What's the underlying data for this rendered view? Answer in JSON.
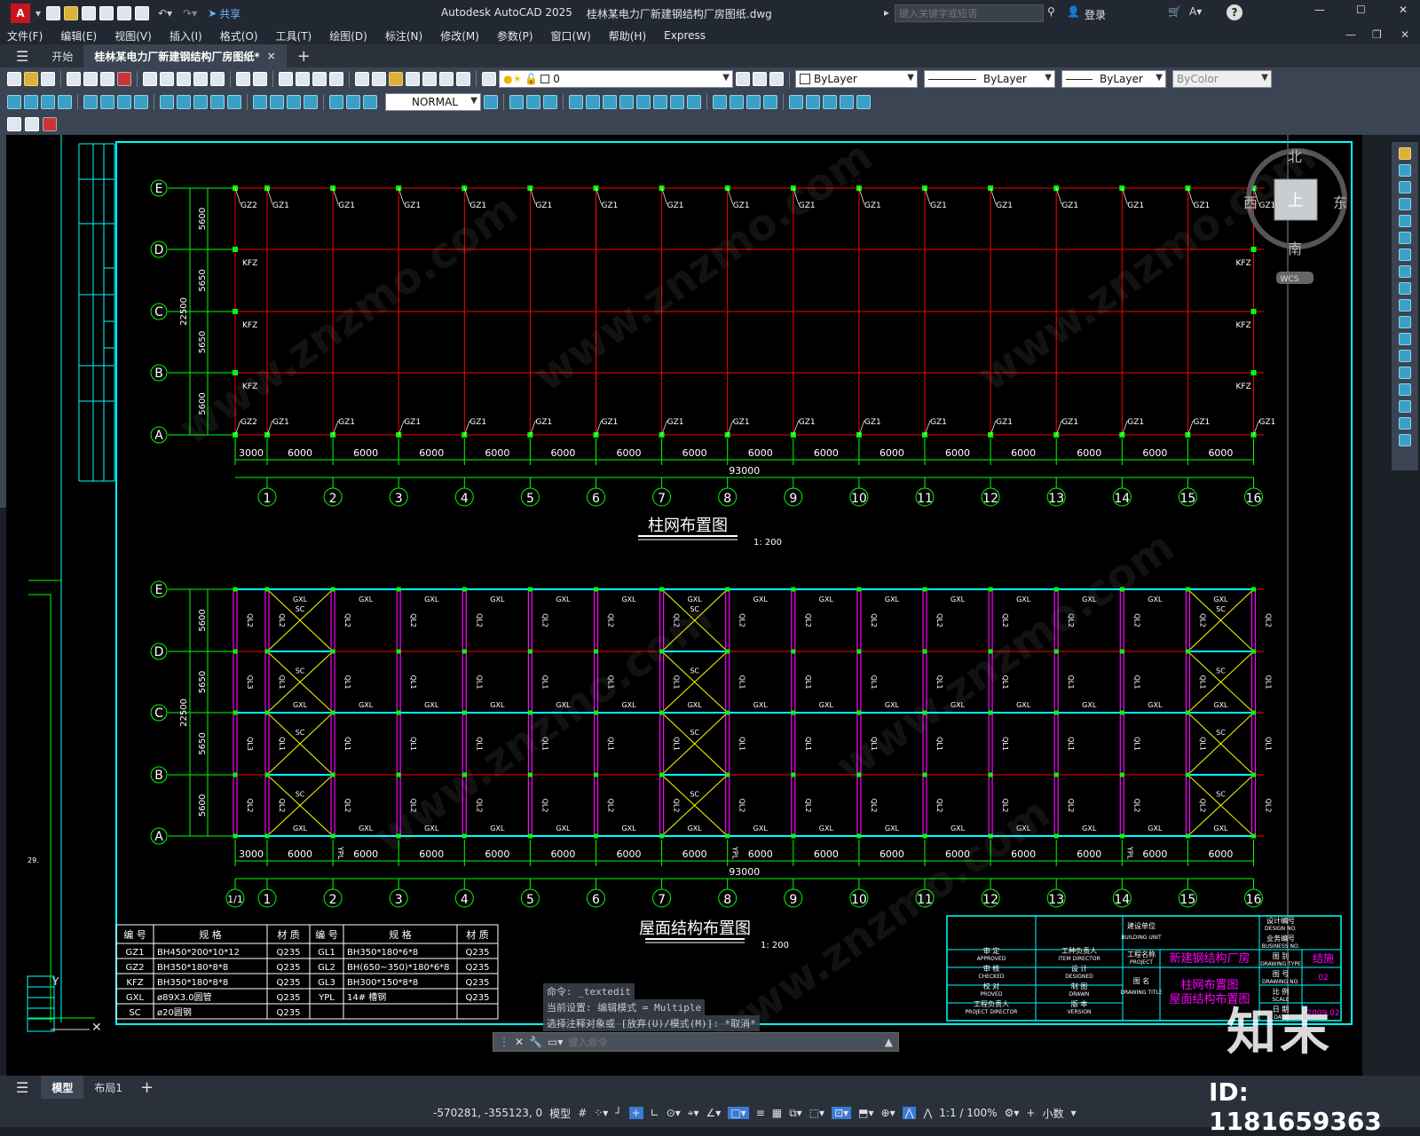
{
  "title": {
    "app_logo": "A",
    "share": "共享",
    "app_name": "Autodesk AutoCAD 2025",
    "file": "桂林某电力厂新建钢结构厂房图纸.dwg",
    "search_placeholder": "键入关键字或短语",
    "login": "登录"
  },
  "menu": [
    "文件(F)",
    "编辑(E)",
    "视图(V)",
    "插入(I)",
    "格式(O)",
    "工具(T)",
    "绘图(D)",
    "标注(N)",
    "修改(M)",
    "参数(P)",
    "窗口(W)",
    "帮助(H)",
    "Express"
  ],
  "tabs": {
    "start": "开始",
    "drawing": "桂林某电力厂新建钢结构厂房图纸*",
    "close": "×",
    "add": "+"
  },
  "props": {
    "layer": "0",
    "color": "ByLayer",
    "linetype": "ByLayer",
    "lineweight": "ByLayer",
    "plotstyle": "ByColor",
    "textstyle": "NORMAL"
  },
  "viewcube": {
    "north": "北",
    "south": "南",
    "east": "东",
    "west": "西",
    "top": "上",
    "wcs": "WCS"
  },
  "plan1": {
    "title": "柱网布置图",
    "scale": "1: 200",
    "total": "93000",
    "overall": "22500",
    "rows": [
      "E",
      "D",
      "C",
      "B",
      "A"
    ],
    "row_spacings": [
      "5600",
      "5650",
      "5650",
      "5600"
    ],
    "cols": [
      "1",
      "2",
      "3",
      "4",
      "5",
      "6",
      "7",
      "8",
      "9",
      "10",
      "11",
      "12",
      "13",
      "14",
      "15",
      "16"
    ],
    "col_spacings": [
      "3000",
      "6000",
      "6000",
      "6000",
      "6000",
      "6000",
      "6000",
      "6000",
      "6000",
      "6000",
      "6000",
      "6000",
      "6000",
      "6000",
      "6000",
      "6000"
    ],
    "col_label_gz1": "GZ1",
    "col_label_gz2": "GZ2",
    "col_label_kfz": "KFZ"
  },
  "plan2": {
    "title": "屋面结构布置图",
    "scale": "1: 200",
    "total": "93000",
    "overall": "22500",
    "extra_axis": "1/1",
    "labels": {
      "gxl": "GXL",
      "sc": "SC",
      "ql1": "QL1",
      "ql2": "QL2",
      "ql3": "QL3",
      "ypl": "YPL"
    }
  },
  "table": {
    "headers": [
      "编 号",
      "规 格",
      "材 质",
      "编 号",
      "规 格",
      "材 质"
    ],
    "rows": [
      [
        "GZ1",
        "BH450*200*10*12",
        "Q235",
        "GL1",
        "BH350*180*6*8",
        "Q235"
      ],
      [
        "GZ2",
        "BH350*180*8*8",
        "Q235",
        "GL2",
        "BH(650~350)*180*6*8",
        "Q235"
      ],
      [
        "KFZ",
        "BH350*180*8*8",
        "Q235",
        "GL3",
        "BH300*150*8*8",
        "Q235"
      ],
      [
        "GXL",
        "ø89X3.0圆管",
        "Q235",
        "YPL",
        "14# 槽钢",
        "Q235"
      ],
      [
        "SC",
        "ø20圆钢",
        "Q235",
        "",
        "",
        ""
      ]
    ]
  },
  "titleblock": {
    "unit": "建设单位",
    "unit_en": "BUILDING UNIT",
    "project_label": "工程名称",
    "project_en": "PROJECT",
    "project": "新建钢结构厂房",
    "dwg_title_label": "图 名",
    "dwg_title_en": "DRAWING TITLE",
    "dwg_title_1": "柱网布置图",
    "dwg_title_2": "屋面结构布置图",
    "approved": "审 定",
    "approved_en": "APPROVED",
    "checked": "审 核",
    "checked_en": "CHECKED",
    "proved": "校 对",
    "proved_en": "PROVED",
    "director": "工程负责人",
    "director_en": "PROJECT DIRECTOR",
    "item_dir": "工种负责人",
    "item_dir_en": "ITEM DIRECTOR",
    "designed": "设 计",
    "designed_en": "DESIGNED",
    "drawn": "制 图",
    "drawn_en": "DRAWN",
    "version": "版 本",
    "version_en": "VERSION",
    "design_no": "设计编号",
    "design_no_en": "DESIGN NO.",
    "business_no": "业务编号",
    "business_no_en": "BUSINESS NO.",
    "dtype": "图 别",
    "dtype_en": "DRAWING TYPE",
    "dtype_val": "结施",
    "dno": "图 号",
    "dno_en": "DRAWING NO.",
    "dno_val": "02",
    "scale": "比 例",
    "scale_en": "SCALE",
    "date": "日 期",
    "date_en": "DATE",
    "date_val": "2009.02"
  },
  "cmd": {
    "line1": "命令: _textedit",
    "line2": "当前设置: 编辑模式 = Multiple",
    "line3": "选择注释对象或 [放弃(U)/模式(M)]: *取消*",
    "placeholder": "键入命令"
  },
  "layouts": {
    "model": "模型",
    "layout1": "布局1",
    "add": "+"
  },
  "status": {
    "coords": "-570281, -355123, 0",
    "model": "模型",
    "scale": "1:1 / 100%",
    "units": "小数"
  },
  "overlay": {
    "brand": "知末",
    "id": "ID: 1181659363"
  },
  "left_margin_label": "29."
}
